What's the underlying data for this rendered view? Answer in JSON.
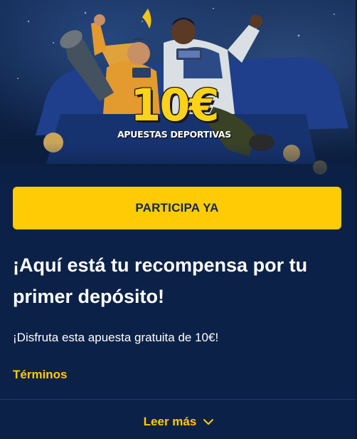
{
  "hero": {
    "amount": "10€",
    "subtitle": "APUESTAS DEPORTIVAS"
  },
  "cta": {
    "label": "PARTICIPA YA"
  },
  "headline": "¡Aquí está tu recompensa por tu primer depósito!",
  "subtext": "¡Disfruta esta apuesta gratuita de 10€!",
  "terms": {
    "label": "Términos"
  },
  "read_more": {
    "label": "Leer más",
    "icon": "chevron-down-icon"
  },
  "colors": {
    "background": "#0b2147",
    "accent": "#ffcb05",
    "cta_text": "#13284d",
    "text": "#ffffff"
  }
}
